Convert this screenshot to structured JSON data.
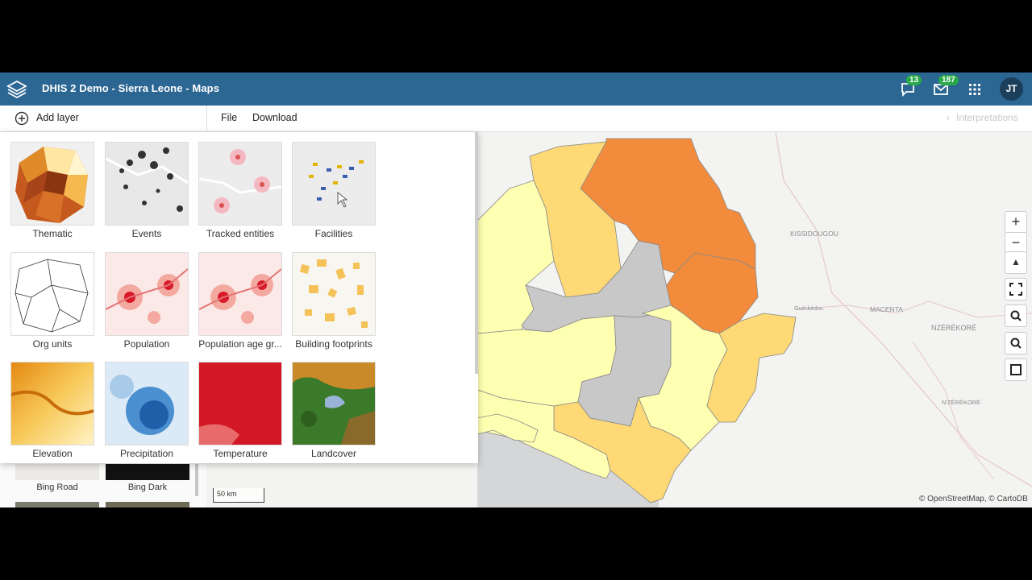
{
  "header": {
    "title": "DHIS 2 Demo - Sierra Leone - Maps",
    "interpretations_badge": "13",
    "messages_badge": "187",
    "avatar_initials": "JT"
  },
  "toolbar": {
    "add_layer": "Add layer",
    "file": "File",
    "download": "Download",
    "interpretations": "Interpretations"
  },
  "layer_types": [
    {
      "label": "Thematic",
      "icon": "thematic-thumbnail"
    },
    {
      "label": "Events",
      "icon": "events-thumbnail"
    },
    {
      "label": "Tracked entities",
      "icon": "tracked-entities-thumbnail"
    },
    {
      "label": "Facilities",
      "icon": "facilities-thumbnail"
    },
    {
      "label": "Org units",
      "icon": "org-units-thumbnail"
    },
    {
      "label": "Population",
      "icon": "population-thumbnail"
    },
    {
      "label": "Population age gr...",
      "icon": "population-age-thumbnail"
    },
    {
      "label": "Building footprints",
      "icon": "building-footprints-thumbnail"
    },
    {
      "label": "Elevation",
      "icon": "elevation-thumbnail"
    },
    {
      "label": "Precipitation",
      "icon": "precipitation-thumbnail"
    },
    {
      "label": "Temperature",
      "icon": "temperature-thumbnail"
    },
    {
      "label": "Landcover",
      "icon": "landcover-thumbnail"
    }
  ],
  "basemaps": [
    {
      "label": "Bing Road"
    },
    {
      "label": "Bing Dark"
    }
  ],
  "map": {
    "place_labels": [
      "KISSIDOUGOU",
      "Guéckédou",
      "MACENTA",
      "NZÉRÉKORÉ",
      "N'ZÉRÉKORÉ"
    ],
    "attribution": "© OpenStreetMap, © CartoDB",
    "scale": "50 km"
  },
  "colors": {
    "header": "#2c6693",
    "choropleth_low": "#ffffb2",
    "choropleth_mid": "#fed976",
    "choropleth_high": "#f28c3c",
    "no_data": "#c8c8c8"
  }
}
